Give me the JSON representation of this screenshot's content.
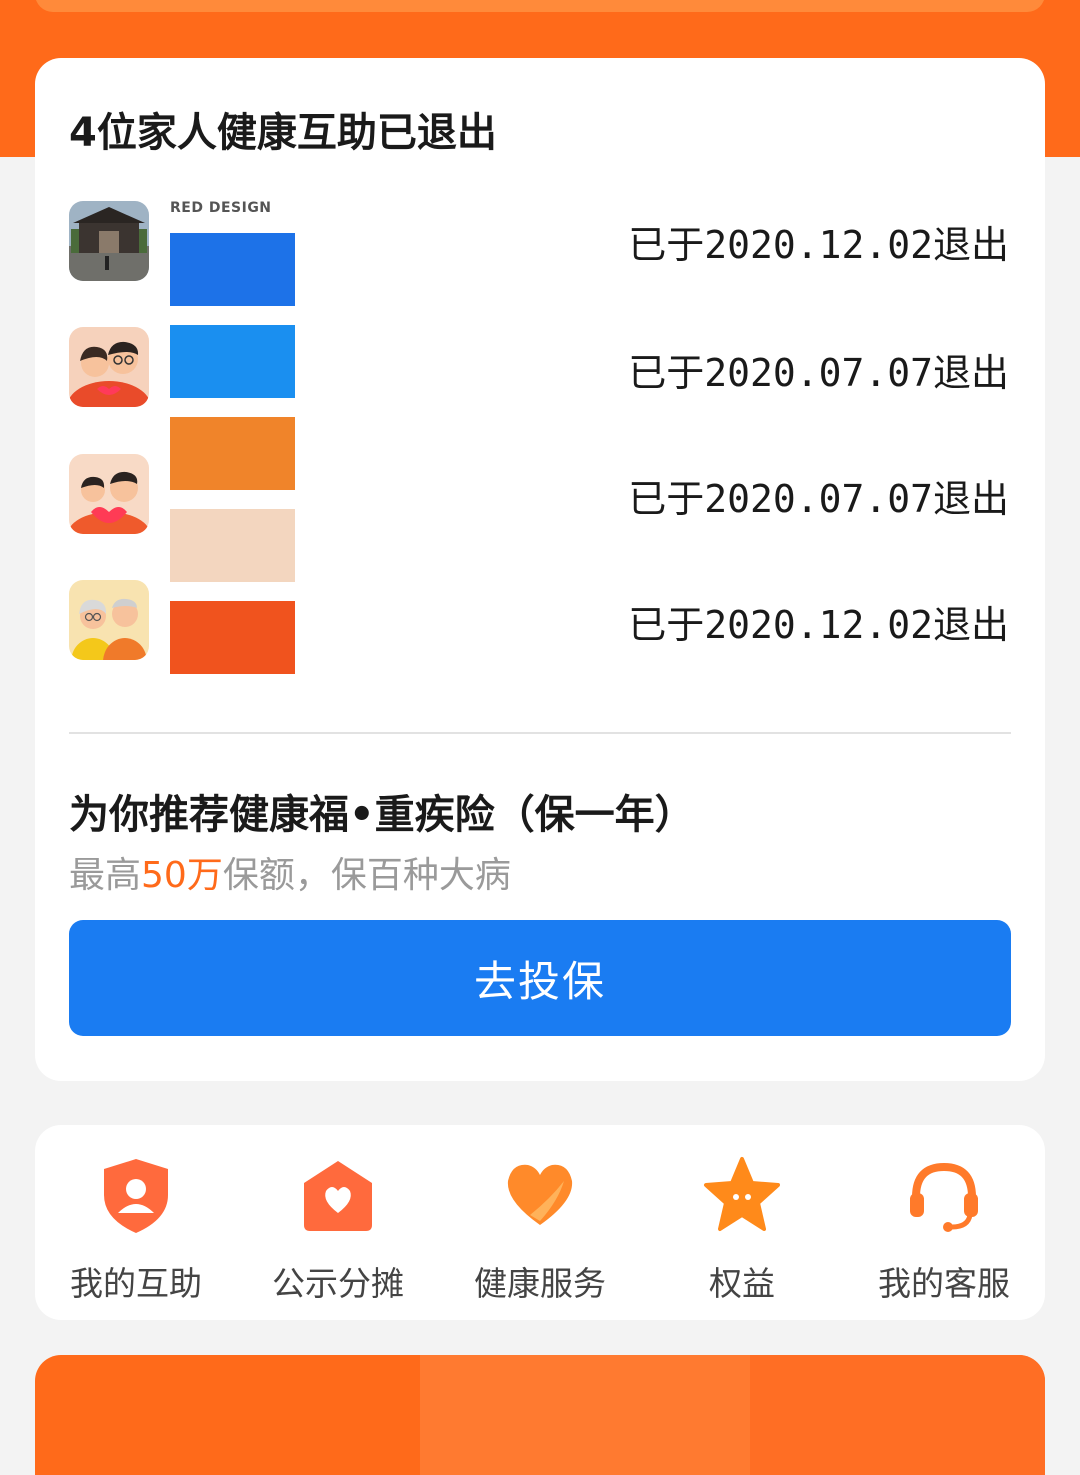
{
  "colors": {
    "brand_orange": "#ff6a1a",
    "primary_blue": "#1a7cf2"
  },
  "exited_card": {
    "title": "4位家人健康互助已退出",
    "members": [
      {
        "avatar_icon": "temple-photo-avatar",
        "status": "已于2020.12.02退出"
      },
      {
        "avatar_icon": "young-couple-avatar",
        "status": "已于2020.07.07退出"
      },
      {
        "avatar_icon": "couple-heart-avatar",
        "status": "已于2020.07.07退出"
      },
      {
        "avatar_icon": "elderly-couple-avatar",
        "status": "已于2020.12.02退出"
      }
    ],
    "palette": {
      "caption": "RED DESIGN",
      "swatches": [
        "#1d72e8",
        "#1a8ff0",
        "#f0842a",
        "#f3d6bf",
        "#f0531e"
      ]
    }
  },
  "recommend": {
    "title": "为你推荐健康福•重疾险（保一年）",
    "subtitle_prefix": "最高",
    "subtitle_highlight": "50万",
    "subtitle_suffix": "保额，保百种大病",
    "button_label": "去投保"
  },
  "nav": {
    "items": [
      {
        "label": "我的互助",
        "icon": "shield-person-icon"
      },
      {
        "label": "公示分摊",
        "icon": "house-heart-icon"
      },
      {
        "label": "健康服务",
        "icon": "heart-hand-icon"
      },
      {
        "label": "权益",
        "icon": "star-icon"
      },
      {
        "label": "我的客服",
        "icon": "headset-icon"
      }
    ]
  }
}
